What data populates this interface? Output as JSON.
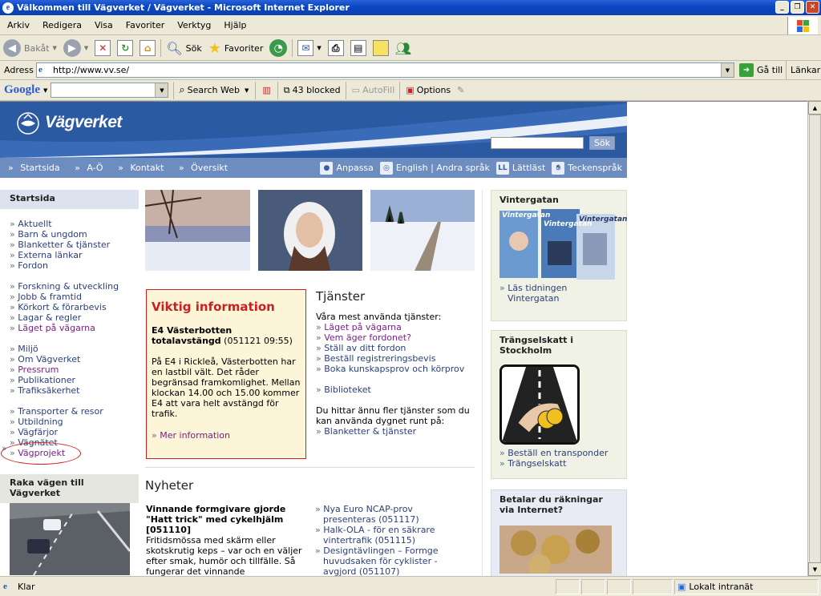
{
  "window": {
    "title": "Välkommen till Vägverket / Vägverket - Microsoft Internet Explorer"
  },
  "menu": [
    "Arkiv",
    "Redigera",
    "Visa",
    "Favoriter",
    "Verktyg",
    "Hjälp"
  ],
  "toolbar": {
    "back": "Bakåt",
    "search": "Sök",
    "favorites": "Favoriter"
  },
  "address": {
    "label": "Adress",
    "url": "http://www.vv.se/",
    "go": "Gå till",
    "links": "Länkar"
  },
  "googlebar": {
    "brand": "Google",
    "search_web": "Search Web",
    "blocked": "43 blocked",
    "autofill": "AutoFill",
    "options": "Options"
  },
  "site": {
    "logo": "Vägverket",
    "search_button": "Sök",
    "nav_left": [
      "Startsida",
      "A-Ö",
      "Kontakt",
      "Översikt"
    ],
    "nav_right": [
      "Anpassa",
      "English | Andra språk",
      "Lättläst",
      "Teckenspråk"
    ],
    "nav_icon_letters": [
      "LL"
    ]
  },
  "left": {
    "heading": "Startsida",
    "groups": [
      [
        "Aktuellt",
        "Barn & ungdom",
        "Blanketter & tjänster",
        "Externa länkar",
        "Fordon"
      ],
      [
        "Forskning & utveckling",
        "Jobb & framtid",
        "Körkort & förarbevis",
        "Lagar & regler",
        "Läget på vägarna"
      ],
      [
        "Miljö",
        "Om Vägverket",
        "Pressrum",
        "Publikationer",
        "Trafiksäkerhet"
      ],
      [
        "Transporter & resor",
        "Utbildning",
        "Vägfärjor",
        "Vägnätet",
        "Vägprojekt"
      ]
    ],
    "promo_title": "Raka vägen till Vägverket"
  },
  "important": {
    "title": "Viktig information",
    "headline": "E4 Västerbotten totalavstängd",
    "date": "(051121 09:55)",
    "body": "På E4 i Rickleå, Västerbotten har en lastbil vält. Det råder begränsad framkomlighet. Mellan klockan 14.00 och 15.00 kommer E4 att vara helt avstängd för trafik.",
    "more": "Mer information"
  },
  "services": {
    "title": "Tjänster",
    "intro": "Våra mest använda tjänster:",
    "items": [
      "Läget på vägarna",
      "Vem äger fordonet?",
      "Ställ av ditt fordon",
      "Beställ registreringsbevis",
      "Boka kunskapsprov och körprov",
      "Biblioteket"
    ],
    "more_intro": "Du hittar ännu fler tjänster som du kan använda dygnet runt på:",
    "more_link": "Blanketter & tjänster"
  },
  "news": {
    "title": "Nyheter",
    "main_title": "Vinnande formgivare gjorde \"Hatt trick\" med cykelhjälm [051110]",
    "main_body": "Fritidsmössa med skärm eller skotskrutig keps – var och en väljer efter smak, humör och tillfälle. Så fungerar det vinnande",
    "items": [
      "Nya Euro NCAP-prov presenteras (051117)",
      "Halk-OLA - för en säkrare vintertrafik (051115)",
      "Designtävlingen – Formge huvudsaken för cyklister - avgjord (051107)"
    ]
  },
  "right": {
    "vintergatan_title": "Vintergatan",
    "magazine_name": "Vintergatan",
    "vintergatan_link": "Läs tidningen Vintergatan",
    "congestion_title": "Trängselskatt i Stockholm",
    "congestion_links": [
      "Beställ en transponder",
      "Trängselskatt"
    ],
    "bills_title": "Betalar du räkningar via Internet?"
  },
  "status": {
    "text": "Klar",
    "zone": "Lokalt intranät"
  },
  "colors": {
    "titlebar": "#0b48c4",
    "banner": "#2b5aa3",
    "navbar": "#6d8cc0",
    "link": "#2a3f7a",
    "visited": "#7a1f88",
    "alert": "#cc1f1f",
    "highlight_circle": "#d42020"
  }
}
